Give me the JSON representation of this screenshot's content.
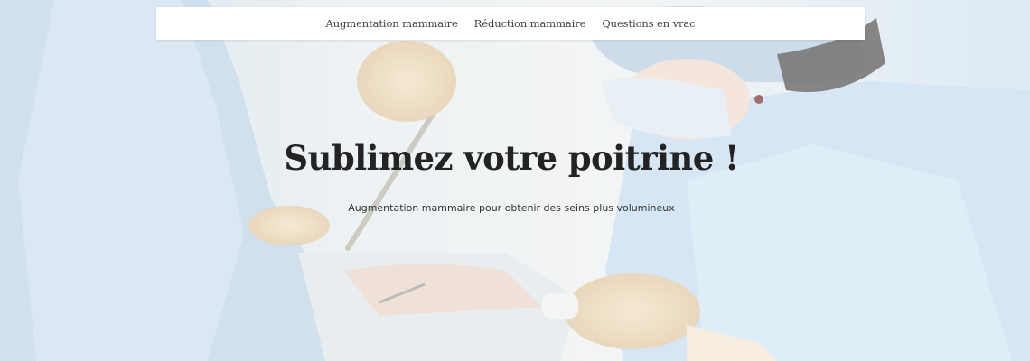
{
  "nav": {
    "items": [
      {
        "label": "Augmentation mammaire"
      },
      {
        "label": "Réduction mammaire"
      },
      {
        "label": "Questions en vrac"
      }
    ]
  },
  "hero": {
    "title": "Sublimez votre poitrine !",
    "subtitle": "Augmentation mammaire pour obtenir des seins plus volumineux",
    "image_subject": "surgeons operating in a bright operating room"
  },
  "colors": {
    "nav_background": "#ffffff",
    "nav_text": "#3f3f3f",
    "title_text": "#232323",
    "subtitle_text": "#333333",
    "gown_blue": "#bcd6ea"
  }
}
